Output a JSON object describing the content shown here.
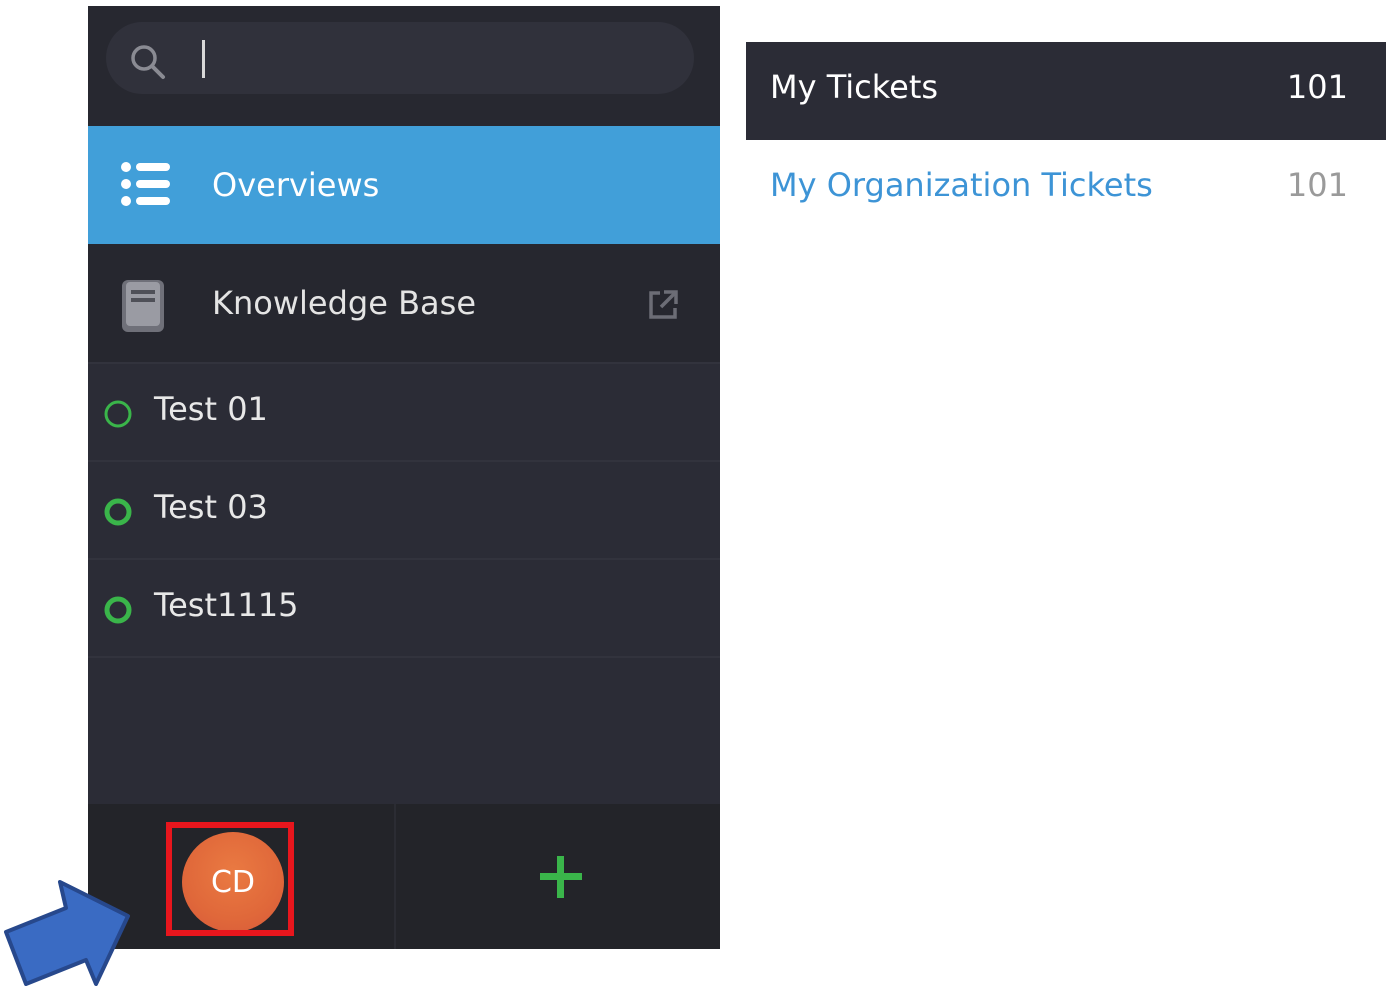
{
  "sidebar": {
    "search": {
      "value": "",
      "placeholder": ""
    },
    "nav": [
      {
        "label": "Overviews",
        "icon": "list-icon",
        "active": true
      },
      {
        "label": "Knowledge Base",
        "icon": "book-icon",
        "external": true
      }
    ],
    "items": [
      {
        "label": "Test 01",
        "status_icon": "circle-outline-icon"
      },
      {
        "label": "Test 03",
        "status_icon": "circle-outline-icon"
      },
      {
        "label": "Test1115",
        "status_icon": "circle-outline-icon"
      }
    ],
    "bottom": {
      "avatar_initials": "CD",
      "add_icon": "plus-icon"
    }
  },
  "overviews": [
    {
      "title": "My Tickets",
      "count": "101",
      "active": true
    },
    {
      "title": "My Organization Tickets",
      "count": "101",
      "active": false
    }
  ],
  "colors": {
    "sidebar_bg": "#2b2c36",
    "active_nav": "#419fd9",
    "status_green": "#3ab54a",
    "link_blue": "#3d94d6",
    "avatar_orange": "#e26c3c",
    "highlight_red": "#e8161d",
    "arrow_blue": "#3a6bc3"
  }
}
